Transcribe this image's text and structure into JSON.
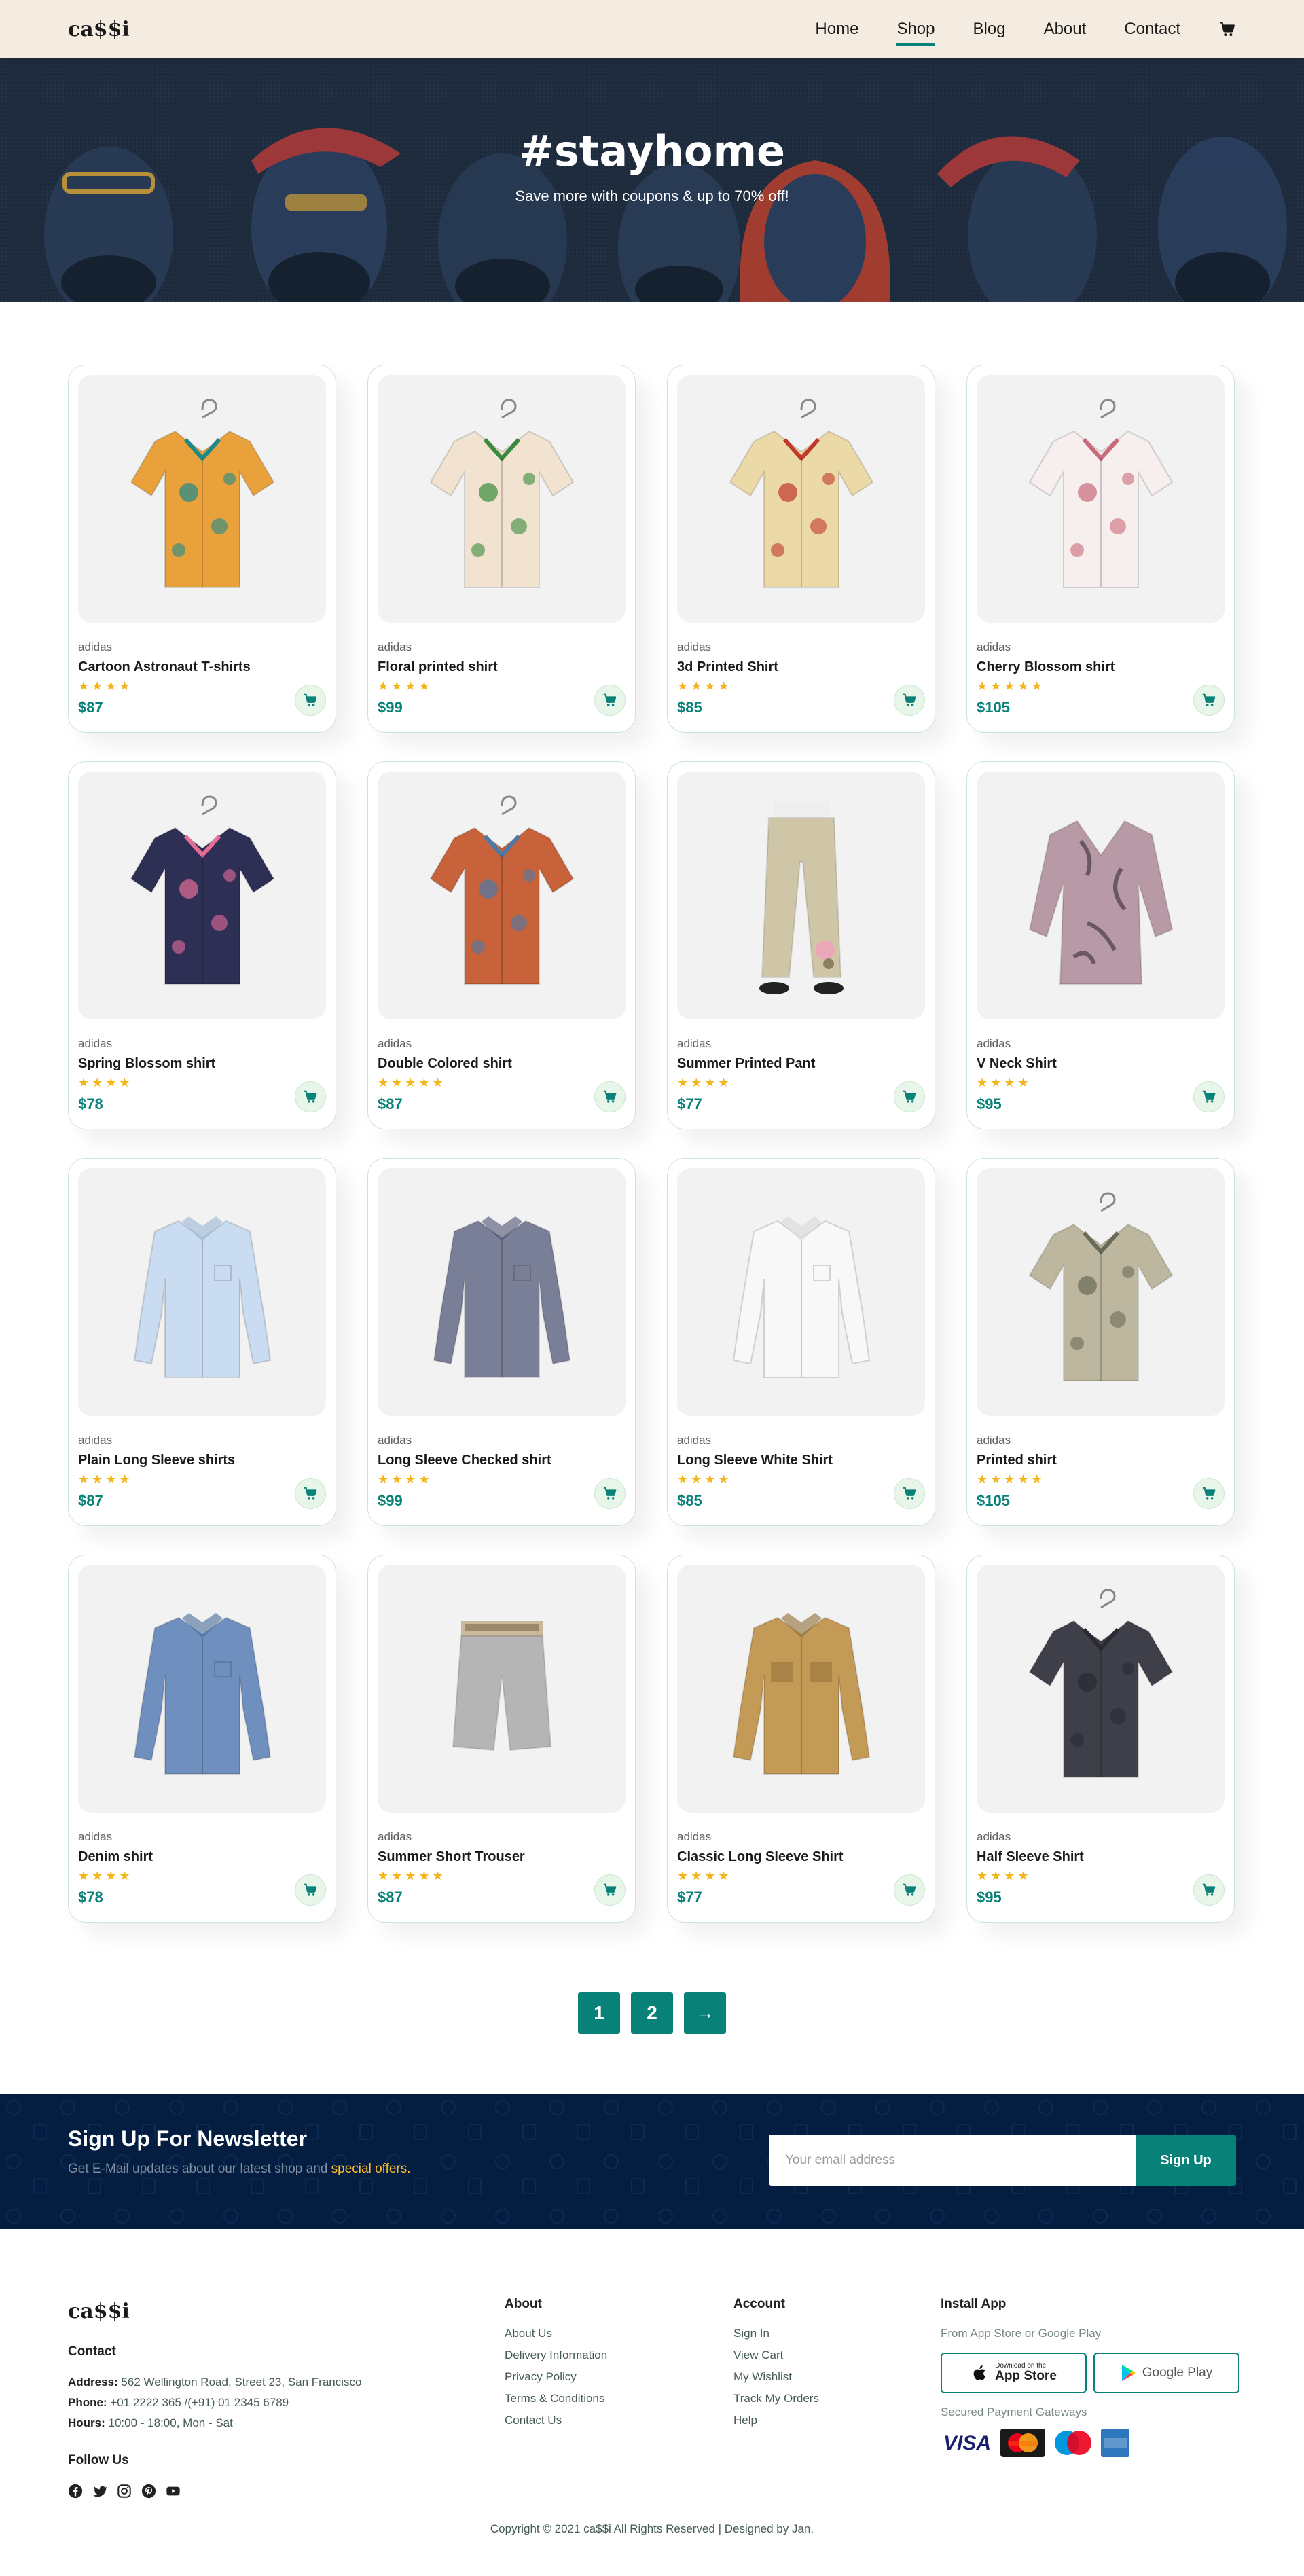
{
  "header": {
    "logo": "ca$$i",
    "nav": [
      "Home",
      "Shop",
      "Blog",
      "About",
      "Contact"
    ],
    "active": "Shop"
  },
  "hero": {
    "title": "#stayhome",
    "subtitle": "Save more with coupons & up to 70% off!"
  },
  "products": [
    {
      "brand": "adidas",
      "name": "Cartoon Astronaut T-shirts",
      "rating": 4,
      "price": "$87",
      "kind": "shirt",
      "color": "#e9a23b",
      "accent": "#1d8a8a"
    },
    {
      "brand": "adidas",
      "name": "Floral printed shirt",
      "rating": 4,
      "price": "$99",
      "kind": "shirt",
      "color": "#f1e3cf",
      "accent": "#3b8a3e"
    },
    {
      "brand": "adidas",
      "name": "3d Printed Shirt",
      "rating": 4,
      "price": "$85",
      "kind": "shirt",
      "color": "#ecd9a8",
      "accent": "#c0392b"
    },
    {
      "brand": "adidas",
      "name": "Cherry Blossom shirt",
      "rating": 5,
      "price": "$105",
      "kind": "shirt",
      "color": "#f7eeee",
      "accent": "#c96a7a"
    },
    {
      "brand": "adidas",
      "name": "Spring Blossom shirt",
      "rating": 4,
      "price": "$78",
      "kind": "shirt",
      "color": "#2e2f55",
      "accent": "#e66d97"
    },
    {
      "brand": "adidas",
      "name": "Double Colored shirt",
      "rating": 5,
      "price": "$87",
      "kind": "shirt",
      "color": "#c8623a",
      "accent": "#4b79a8"
    },
    {
      "brand": "adidas",
      "name": "Summer Printed Pant",
      "rating": 4,
      "price": "$77",
      "kind": "pant",
      "color": "#cfc6a8",
      "accent": "#8a8060"
    },
    {
      "brand": "adidas",
      "name": "V Neck Shirt",
      "rating": 4,
      "price": "$95",
      "kind": "blouse",
      "color": "#b89aa6",
      "accent": "#4a3a44"
    },
    {
      "brand": "adidas",
      "name": "Plain Long Sleeve shirts",
      "rating": 4,
      "price": "$87",
      "kind": "longshirt",
      "color": "#c9dcf1",
      "accent": "#9bb6d6"
    },
    {
      "brand": "adidas",
      "name": "Long Sleeve Checked shirt",
      "rating": 4,
      "price": "$99",
      "kind": "longshirt",
      "color": "#7a7f98",
      "accent": "#4d5270"
    },
    {
      "brand": "adidas",
      "name": "Long Sleeve White Shirt",
      "rating": 4,
      "price": "$85",
      "kind": "longshirt",
      "color": "#f8f8f8",
      "accent": "#d8d8d8"
    },
    {
      "brand": "adidas",
      "name": "Printed shirt",
      "rating": 5,
      "price": "$105",
      "kind": "shirt",
      "color": "#bdb79f",
      "accent": "#6a6a58"
    },
    {
      "brand": "adidas",
      "name": "Denim shirt",
      "rating": 4,
      "price": "$78",
      "kind": "longshirt",
      "color": "#6f8fbf",
      "accent": "#4a6a9a"
    },
    {
      "brand": "adidas",
      "name": "Summer Short Trouser",
      "rating": 5,
      "price": "$87",
      "kind": "short",
      "color": "#b5b5b5",
      "accent": "#8a8a8a"
    },
    {
      "brand": "adidas",
      "name": "Classic Long Sleeve Shirt",
      "rating": 4,
      "price": "$77",
      "kind": "jacket",
      "color": "#c49a57",
      "accent": "#8e6b34"
    },
    {
      "brand": "adidas",
      "name": "Half Sleeve Shirt",
      "rating": 4,
      "price": "$95",
      "kind": "shirt",
      "color": "#3f3f4a",
      "accent": "#2a2a33"
    }
  ],
  "pagination": [
    "1",
    "2",
    "→"
  ],
  "newsletter": {
    "title": "Sign Up For Newsletter",
    "subtitle": "Get E-Mail updates about our latest shop and",
    "highlight": "special offers.",
    "placeholder": "Your email address",
    "button": "Sign Up"
  },
  "footer": {
    "logo": "ca$$i",
    "contact_title": "Contact",
    "address_label": "Address:",
    "address": "562 Wellington Road, Street 23, San Francisco",
    "phone_label": "Phone:",
    "phone": "+01 2222 365 /(+91) 01 2345 6789",
    "hours_label": "Hours:",
    "hours": "10:00 - 18:00, Mon - Sat",
    "follow_title": "Follow Us",
    "about_title": "About",
    "about_links": [
      "About Us",
      "Delivery Information",
      "Privacy Policy",
      "Terms & Conditions",
      "Contact Us"
    ],
    "account_title": "Account",
    "account_links": [
      "Sign In",
      "View Cart",
      "My Wishlist",
      "Track My Orders",
      "Help"
    ],
    "install_title": "Install App",
    "install_sub": "From App Store or Google Play",
    "appstore_small": "Download on the",
    "appstore_big": "App Store",
    "googleplay": "Google Play",
    "payment_title": "Secured Payment Gateways",
    "copyright": "Copyright © 2021 ca$$i All Rights Reserved | Designed by Jan."
  },
  "icons": {
    "cart": "cart-icon",
    "socials": [
      "facebook-icon",
      "twitter-icon",
      "instagram-icon",
      "pinterest-icon",
      "youtube-icon"
    ]
  },
  "colors": {
    "brand": "#088178",
    "header_bg": "#f4ece0",
    "newsletter_bg": "#041e42",
    "star": "#f3b519"
  }
}
